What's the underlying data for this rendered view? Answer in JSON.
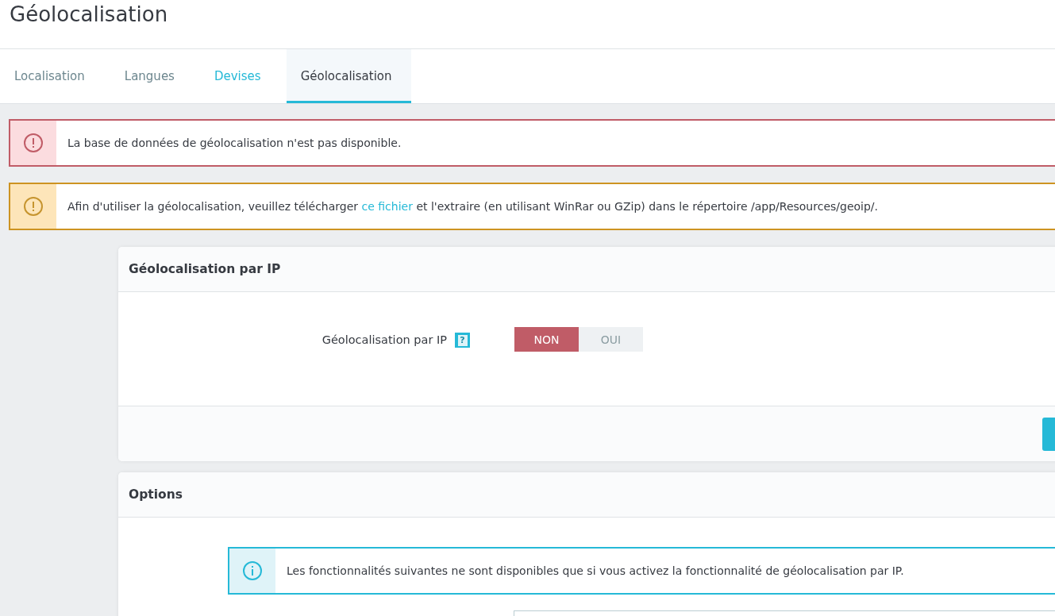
{
  "page_title": "Géolocalisation",
  "tabs": [
    {
      "label": "Localisation",
      "selected": false,
      "hovered": false
    },
    {
      "label": "Langues",
      "selected": false,
      "hovered": false
    },
    {
      "label": "Devises",
      "selected": false,
      "hovered": true
    },
    {
      "label": "Géolocalisation",
      "selected": true,
      "hovered": false
    }
  ],
  "alerts": [
    {
      "kind": "error",
      "before": "La base de données de géolocalisation n'est pas disponible."
    },
    {
      "kind": "warning",
      "before": "Afin d'utiliser la géolocalisation, veuillez télécharger ",
      "link": "ce fichier",
      "after": " et l'extraire (en utilisant WinRar ou GZip) dans le répertoire /app/Resources/geoip/."
    }
  ],
  "cards": [
    {
      "title": "Géolocalisation par IP",
      "field_label": "Géolocalisation par IP",
      "help": "?",
      "toggle": [
        {
          "label": "NON",
          "selected": true,
          "kind": "off"
        },
        {
          "label": "OUI",
          "selected": false,
          "kind": "on"
        }
      ]
    },
    {
      "title": "Options",
      "info": {
        "kind": "info",
        "before": "Les fonctionnalités suivantes ne sont disponibles que si vous activez la fonctionnalité de géolocalisation par IP."
      }
    }
  ]
}
